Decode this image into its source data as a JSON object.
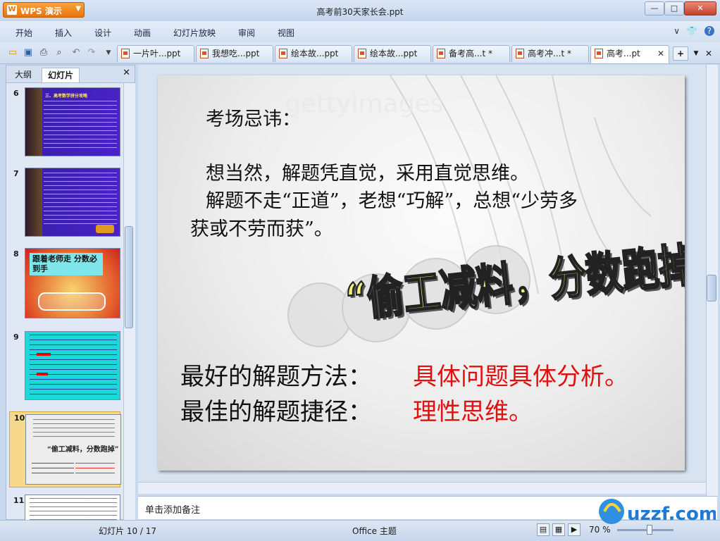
{
  "app": {
    "wps_label": "WPS 演示",
    "title": "高考前30天家长会.ppt",
    "window_buttons": {
      "minimize": "—",
      "maximize": "□",
      "close": "✕"
    }
  },
  "menu": {
    "items": [
      "开始",
      "插入",
      "设计",
      "动画",
      "幻灯片放映",
      "审阅",
      "视图"
    ],
    "right": {
      "min": "∨",
      "shirt": "👕",
      "help": "?"
    }
  },
  "toolbar": {
    "icons": [
      "open-icon",
      "save-icon",
      "print-icon",
      "print-preview-icon",
      "undo-icon",
      "redo-icon",
      "dropdown-icon"
    ],
    "tabs": [
      {
        "label": "一片叶...ppt"
      },
      {
        "label": "我想吃...ppt"
      },
      {
        "label": "绘本故...ppt"
      },
      {
        "label": "绘本故...ppt"
      },
      {
        "label": "备考高...t *"
      },
      {
        "label": "高考冲...t *"
      },
      {
        "label": "高考...pt",
        "close": "✕"
      }
    ],
    "new_tab": "+"
  },
  "left_pane": {
    "tabs": [
      "大纲",
      "幻灯片"
    ],
    "close": "✕",
    "thumbnails": [
      {
        "number": "6",
        "title": "三、高考数学拼分攻略"
      },
      {
        "number": "7",
        "title": ""
      },
      {
        "number": "8",
        "title": "跟着老师走 分数必到手"
      },
      {
        "number": "9",
        "title": ""
      },
      {
        "number": "10",
        "title": "“偷工减料，分数跑掉”"
      },
      {
        "number": "11",
        "title": ""
      }
    ]
  },
  "slide": {
    "heading": "考场忌讳：",
    "line1": "想当然，解题凭直觉，采用直觉思维。",
    "line2": "解题不走“正道”，老想“巧解”，总想“少劳多",
    "line3": "获或不劳而获”。",
    "wordart": "“偷工减料，分数跑掉”",
    "best_method_label": "最好的解题方法：",
    "best_method_value": "具体问题具体分析。",
    "best_path_label": "最佳的解题捷径：",
    "best_path_value": "理性思维。",
    "watermark_text": "gettyimages"
  },
  "notes": {
    "placeholder": "单击添加备注"
  },
  "status": {
    "slide_indicator": "幻灯片 10 / 17",
    "theme": "Office 主题",
    "zoom": "70 %"
  },
  "colors": {
    "accent_red": "#e01010",
    "wordart_fill": "#f2ee7a",
    "wps_orange": "#e8730f"
  }
}
